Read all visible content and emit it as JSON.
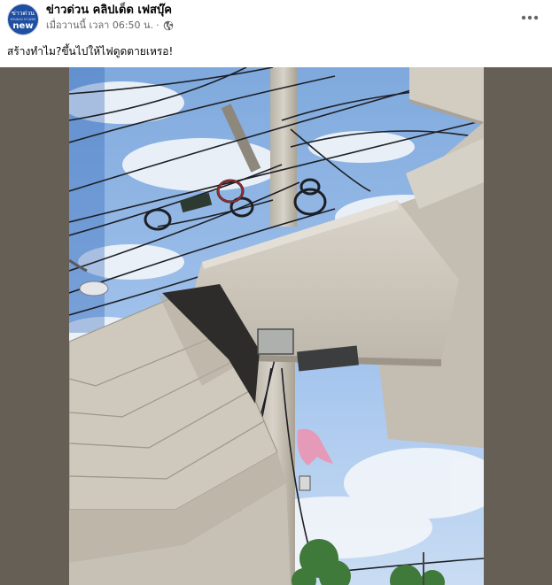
{
  "page": {
    "name": "ข่าวด่วน คลิปเด็ด เฟสบุ๊ค",
    "avatar": {
      "top_text": "ข่าวด่วน",
      "middle_text": "หลงมอง ทางเพจ",
      "bottom_text": "new"
    }
  },
  "post": {
    "time_text": "เมื่อวานนี้ เวลา 06:50 น.",
    "separator": "·",
    "privacy_icon": "globe-icon",
    "more_icon": "more-options-icon",
    "caption": "สร้างทำไม?ขึ้นไปให้ไฟดูดตายเหรอ!"
  },
  "media": {
    "description_icon": "photo",
    "colors": {
      "sky": "#8fb8e8",
      "cloud": "#f2f5f9",
      "concrete": "#d4cfc4",
      "concrete_shadow": "#a39c8f",
      "pole": "#c9c4b8",
      "letterbox": "#655f55"
    }
  }
}
